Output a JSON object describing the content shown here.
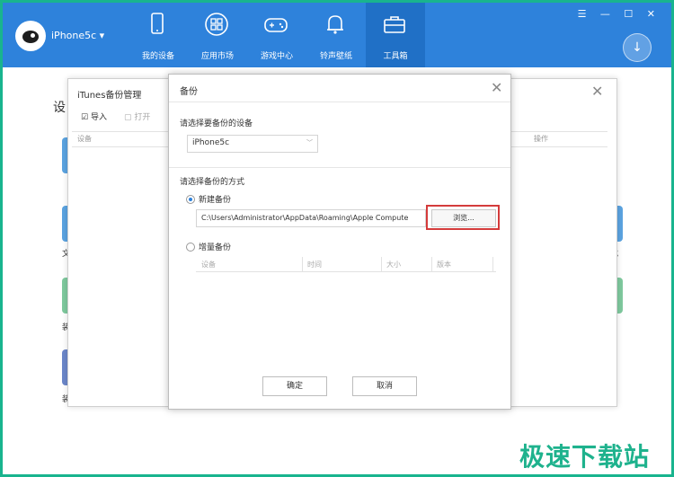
{
  "app": {
    "device_name": "iPhone5c ▾",
    "win_controls": "☰ — ☐ ✕",
    "tabs": [
      {
        "label": "我的设备",
        "icon": "phone-icon"
      },
      {
        "label": "应用市场",
        "icon": "apps-icon"
      },
      {
        "label": "游戏中心",
        "icon": "gamepad-icon"
      },
      {
        "label": "铃声壁纸",
        "icon": "bell-icon"
      },
      {
        "label": "工具箱",
        "icon": "toolbox-icon"
      }
    ],
    "active_tab": "工具箱",
    "download_icon": "↓"
  },
  "background": {
    "title": "设",
    "left_tiles": [
      "文",
      "装",
      "装"
    ],
    "right_tiles": [
      "载",
      "拟器"
    ]
  },
  "itunes_window": {
    "title": "iTunes备份管理",
    "import_label": "导入",
    "open_label": "打开",
    "col_device": "设备",
    "col_action": "操作",
    "close": "✕"
  },
  "backup_dialog": {
    "title": "备份",
    "close": "✕",
    "select_device_label": "请选择要备份的设备",
    "device_value": "iPhone5c",
    "select_method_label": "请选择备份的方式",
    "new_backup_label": "新建备份",
    "path_value": "C:\\Users\\Administrator\\AppData\\Roaming\\Apple Compute",
    "browse_label": "浏览...",
    "incremental_label": "增量备份",
    "inc_columns": [
      "设备",
      "时间",
      "大小",
      "版本"
    ],
    "ok_label": "确定",
    "cancel_label": "取消"
  },
  "colors": {
    "topbar": "#2e82db",
    "active_tab": "#2070c6",
    "frame_border": "#19b48e",
    "highlight": "#d43b3b"
  },
  "watermark": "极速下载站"
}
